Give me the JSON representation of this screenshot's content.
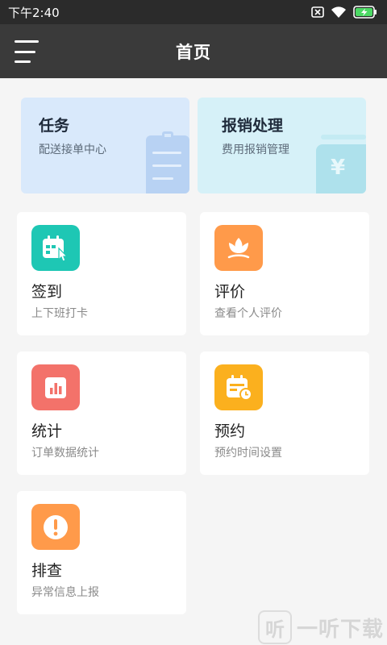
{
  "status_bar": {
    "time": "下午2:40",
    "icons": [
      "sim-off-icon",
      "wifi-icon",
      "battery-charging-icon"
    ]
  },
  "header": {
    "title": "首页",
    "menu_icon": "hamburger-menu-icon"
  },
  "top_cards": [
    {
      "title": "任务",
      "subtitle": "配送接单中心",
      "icon": "clipboard-icon",
      "bg": "#d9e9fb"
    },
    {
      "title": "报销处理",
      "subtitle": "费用报销管理",
      "icon": "wallet-yen-icon",
      "bg": "#d6f1f8"
    }
  ],
  "grid_cards": [
    {
      "title": "签到",
      "subtitle": "上下班打卡",
      "icon": "calendar-tap-icon",
      "color": "#1ec7b4"
    },
    {
      "title": "评价",
      "subtitle": "查看个人评价",
      "icon": "flower-icon",
      "color": "#ff9a4a"
    },
    {
      "title": "统计",
      "subtitle": "订单数据统计",
      "icon": "bar-chart-icon",
      "color": "#f3726a"
    },
    {
      "title": "预约",
      "subtitle": "预约时间设置",
      "icon": "calendar-clock-icon",
      "color": "#fbb01e"
    },
    {
      "title": "排查",
      "subtitle": "异常信息上报",
      "icon": "alert-icon",
      "color": "#ff9a4a"
    }
  ],
  "watermark": {
    "logo_text": "听",
    "text": "一听下载"
  },
  "colors": {
    "status_bar": "#2b2b2b",
    "header": "#3a3a3a",
    "page_bg": "#f5f5f5"
  }
}
